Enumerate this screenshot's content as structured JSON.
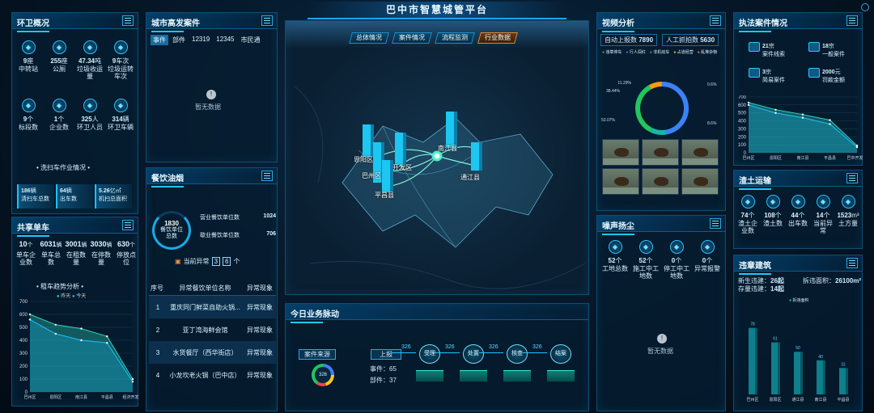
{
  "header": {
    "title": "巴中市智慧城管平台"
  },
  "panels": {
    "sanitation": {
      "title": "环卫概况",
      "subtitle": "洗扫车作业情况",
      "stats": [
        {
          "num": "9",
          "unit": "座",
          "label": "中转站",
          "icon": "house-icon"
        },
        {
          "num": "255",
          "unit": "座",
          "label": "公厕",
          "icon": "toilet-icon"
        },
        {
          "num": "47.34",
          "unit": "吨",
          "label": "垃圾收运量",
          "icon": "truck-icon"
        },
        {
          "num": "9",
          "unit": "车次",
          "label": "垃圾运转车次",
          "icon": "truck-icon"
        },
        {
          "num": "9",
          "unit": "个",
          "label": "标段数",
          "icon": "flag-icon"
        },
        {
          "num": "1",
          "unit": "个",
          "label": "企业数",
          "icon": "building-icon"
        },
        {
          "num": "325",
          "unit": "人",
          "label": "环卫人员",
          "icon": "person-icon"
        },
        {
          "num": "314",
          "unit": "辆",
          "label": "环卫车辆",
          "icon": "car-icon"
        }
      ],
      "cards": [
        {
          "num": "186",
          "unit": "辆",
          "label": "清扫车总数"
        },
        {
          "num": "64",
          "unit": "辆",
          "label": "出车数"
        },
        {
          "num": "5.26",
          "unit": "亿㎡",
          "label": "机扫总面积"
        }
      ]
    },
    "events": {
      "title": "城市高发案件",
      "tabs": [
        "事件",
        "部件",
        "12319",
        "12345",
        "市民通"
      ],
      "empty": "暂无数据"
    },
    "catering": {
      "title": "餐饮油烟",
      "total": "1830",
      "total_label": "餐饮单位总数",
      "items": [
        {
          "label": "营业餐饮单位数",
          "value": "1024"
        },
        {
          "label": "歇业餐饮单位数",
          "value": "706"
        }
      ],
      "abnormal_label": "当前异常",
      "abnormal_digits": [
        "3",
        "6"
      ],
      "abnormal_unit": "个",
      "table": {
        "headers": [
          "序号",
          "异常餐饮单位名称",
          "异常现象"
        ],
        "rows": [
          [
            "1",
            "重庆同门鲜菜自助火锅...",
            "异常现象"
          ],
          [
            "2",
            "亚丁湾海鲜会馆",
            "异常现象"
          ],
          [
            "3",
            "水货餐厅（西华街店）",
            "异常现象"
          ],
          [
            "4",
            "小龙坎老火锅（巴中店）",
            "异常现象"
          ]
        ]
      }
    },
    "bikes": {
      "title": "共享单车",
      "stats": [
        {
          "num": "10",
          "unit": "个",
          "label": "单车企业数"
        },
        {
          "num": "6031",
          "unit": "辆",
          "label": "单车总数"
        },
        {
          "num": "3001",
          "unit": "辆",
          "label": "在租数量"
        },
        {
          "num": "3030",
          "unit": "辆",
          "label": "在停数量"
        },
        {
          "num": "630",
          "unit": "个",
          "label": "停放点位"
        }
      ],
      "chart_title": "租车趋势分析",
      "legend": [
        "昨天",
        "今天"
      ]
    },
    "video": {
      "title": "视频分析",
      "tab1": "自动上报数",
      "tab1v": "7890",
      "tab2": "人工抓拍数",
      "tab2v": "5630",
      "legend": [
        "违章停车",
        "行人闯红",
        "非机动车",
        "占道经营",
        "乱堆杂物"
      ],
      "ring_labels": [
        "0.6%",
        "8.6%",
        "53.07%",
        "38.44%",
        "11.29%"
      ]
    },
    "enforcement": {
      "title": "执法案件情况",
      "items": [
        {
          "num": "21",
          "unit": "宗",
          "label": "案件线索"
        },
        {
          "num": "18",
          "unit": "宗",
          "label": "一般案件"
        },
        {
          "num": "3",
          "unit": "宗",
          "label": "简易案件"
        },
        {
          "num": "2000",
          "unit": "元",
          "label": "罚款金额"
        }
      ]
    },
    "muck": {
      "title": "渣土运输",
      "stats": [
        {
          "num": "74",
          "unit": "个",
          "label": "渣土企业数",
          "icon": "building-icon"
        },
        {
          "num": "108",
          "unit": "个",
          "label": "渣土数",
          "icon": "truck-icon"
        },
        {
          "num": "44",
          "unit": "个",
          "label": "出车数",
          "icon": "car-icon"
        },
        {
          "num": "14",
          "unit": "个",
          "label": "当前异常",
          "icon": "alarm-icon"
        },
        {
          "num": "1523",
          "unit": "m³",
          "label": "土方量",
          "icon": "grid-icon"
        }
      ]
    },
    "noise": {
      "title": "噪声扬尘",
      "stats": [
        {
          "num": "52",
          "unit": "个",
          "label": "工地总数"
        },
        {
          "num": "52",
          "unit": "个",
          "label": "施工中工地数"
        },
        {
          "num": "0",
          "unit": "个",
          "label": "停工中工地数"
        },
        {
          "num": "0",
          "unit": "个",
          "label": "异常报警"
        }
      ],
      "empty": "暂无数据"
    },
    "illegal": {
      "title": "违章建筑",
      "new_label": "新生违建：",
      "new_value": "26起",
      "exist_label": "存量违建：",
      "exist_value": "14起",
      "demolish_label": "拆违面积：",
      "demolish_value": "26100m²",
      "legend": "拆违面积"
    },
    "business": {
      "title": "今日业务脉动",
      "source": "案件来源",
      "ring_value": "326",
      "report": "上报",
      "events": "事件：",
      "events_v": "65",
      "parts": "部件：",
      "parts_v": "37",
      "flow": [
        "受理",
        "处置",
        "核查",
        "结案"
      ],
      "flow_counts": [
        "326",
        "326",
        "326",
        "326"
      ]
    }
  },
  "map_tabs": [
    "总体情况",
    "案件情况",
    "流程监测",
    "行业数据"
  ],
  "map_labels": [
    "恩阳区",
    "巴州区",
    "开发区",
    "南江县",
    "通江县",
    "平昌县"
  ],
  "chart_data": [
    {
      "type": "area",
      "title": "",
      "categories": [
        "巴州区",
        "恩阳区",
        "南江县",
        "平昌县",
        "经济开发区"
      ],
      "ylim": [
        0,
        700
      ],
      "series": [
        {
          "name": "昨天",
          "values": [
            600,
            520,
            490,
            430,
            100
          ]
        },
        {
          "name": "今天",
          "values": [
            560,
            450,
            400,
            380,
            80
          ]
        }
      ]
    },
    {
      "type": "area",
      "title": "",
      "categories": [
        "巴州区",
        "恩阳区",
        "南江县",
        "平昌县",
        "巴中开发区"
      ],
      "ylim": [
        0,
        700
      ],
      "series": [
        {
          "name": "",
          "values": [
            630,
            540,
            480,
            410,
            90
          ]
        },
        {
          "name": "",
          "values": [
            600,
            500,
            440,
            360,
            70
          ]
        }
      ]
    },
    {
      "type": "bar",
      "title": "",
      "categories": [
        "巴州区",
        "恩阳区",
        "通江县",
        "南江县",
        "平昌县"
      ],
      "values": [
        78,
        61,
        50,
        40,
        31
      ]
    },
    {
      "type": "pie",
      "title": "",
      "values": [
        53.07,
        11.29,
        38.44,
        8.6,
        0.6
      ]
    }
  ],
  "colors": {
    "accent": "#19c3ff",
    "orange": "#d58a3d",
    "teal": "#2dd4bf"
  }
}
